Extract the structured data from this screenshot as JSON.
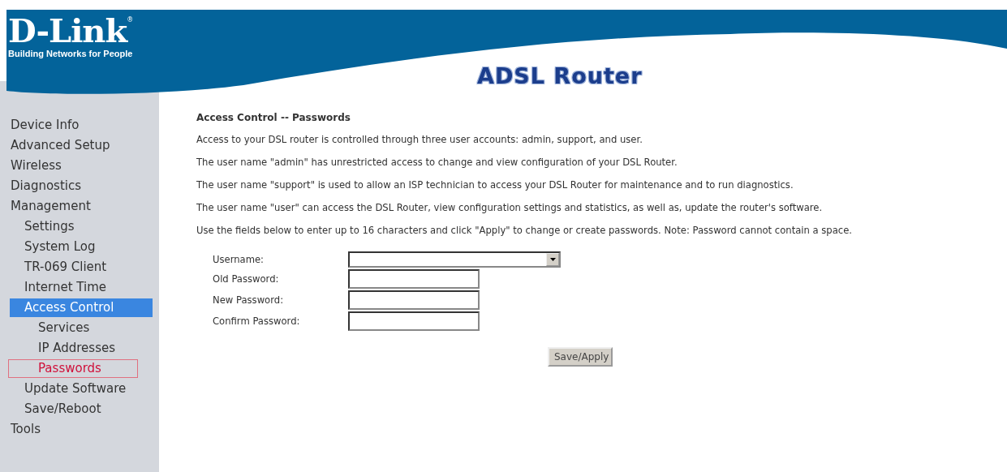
{
  "header": {
    "logo": "D-Link",
    "registered_mark": "®",
    "tagline": "Building Networks for People",
    "title": "ADSL Router"
  },
  "sidebar": {
    "items": [
      {
        "label": "Device Info",
        "highlighted": false,
        "selected": false
      },
      {
        "label": "Advanced Setup",
        "highlighted": false,
        "selected": false
      },
      {
        "label": "Wireless",
        "highlighted": false,
        "selected": false
      },
      {
        "label": "Diagnostics",
        "highlighted": false,
        "selected": false
      },
      {
        "label": "Management",
        "highlighted": false,
        "selected": false,
        "children": [
          {
            "label": "Settings",
            "highlighted": false,
            "selected": false
          },
          {
            "label": "System Log",
            "highlighted": false,
            "selected": false
          },
          {
            "label": "TR-069 Client",
            "highlighted": false,
            "selected": false
          },
          {
            "label": "Internet Time",
            "highlighted": false,
            "selected": false
          },
          {
            "label": "Access Control",
            "highlighted": true,
            "selected": false,
            "children": [
              {
                "label": "Services",
                "highlighted": false,
                "selected": false
              },
              {
                "label": "IP Addresses",
                "highlighted": false,
                "selected": false
              },
              {
                "label": "Passwords",
                "highlighted": false,
                "selected": true
              }
            ]
          },
          {
            "label": "Update Software",
            "highlighted": false,
            "selected": false
          },
          {
            "label": "Save/Reboot",
            "highlighted": false,
            "selected": false
          }
        ]
      },
      {
        "label": "Tools",
        "highlighted": false,
        "selected": false
      }
    ]
  },
  "content": {
    "heading": "Access Control -- Passwords",
    "paragraphs": [
      "Access to your DSL router is controlled through three user accounts: admin, support, and user.",
      "The user name \"admin\" has unrestricted access to change and view configuration of your DSL Router.",
      "The user name \"support\" is used to allow an ISP technician to access your DSL Router for maintenance and to run diagnostics.",
      "The user name \"user\" can access the DSL Router, view configuration settings and statistics, as well as, update the router's software.",
      "Use the fields below to enter up to 16 characters and click \"Apply\" to change or create passwords. Note: Password cannot contain a space."
    ],
    "form": [
      {
        "label": "Username:",
        "kind": "select"
      },
      {
        "label": "Old Password:",
        "kind": "password"
      },
      {
        "label": "New Password:",
        "kind": "password"
      },
      {
        "label": "Confirm Password:",
        "kind": "password"
      }
    ],
    "button": "Save/Apply"
  }
}
